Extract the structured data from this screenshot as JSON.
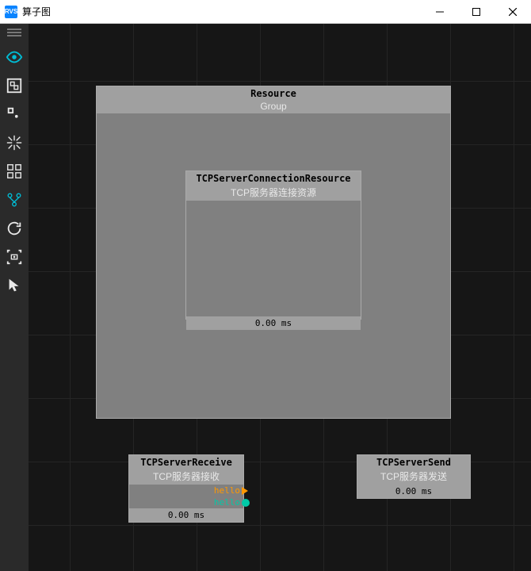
{
  "window": {
    "title": "算子图"
  },
  "sidebar": {
    "tools": [
      "eye",
      "link-box",
      "link-small",
      "snap",
      "grid-boxes",
      "branch",
      "refresh",
      "screenshot",
      "pointer"
    ]
  },
  "nodes": {
    "resource": {
      "title": "Resource",
      "subtitle": "Group",
      "inner": {
        "title": "TCPServerConnectionResource",
        "subtitle": "TCP服务器连接资源",
        "timing": "0.00 ms"
      }
    },
    "receive": {
      "title": "TCPServerReceive",
      "subtitle": "TCP服务器接收",
      "out1": "hello",
      "out2": "hello",
      "timing": "0.00 ms"
    },
    "send": {
      "title": "TCPServerSend",
      "subtitle": "TCP服务器发送",
      "timing": "0.00 ms"
    }
  }
}
